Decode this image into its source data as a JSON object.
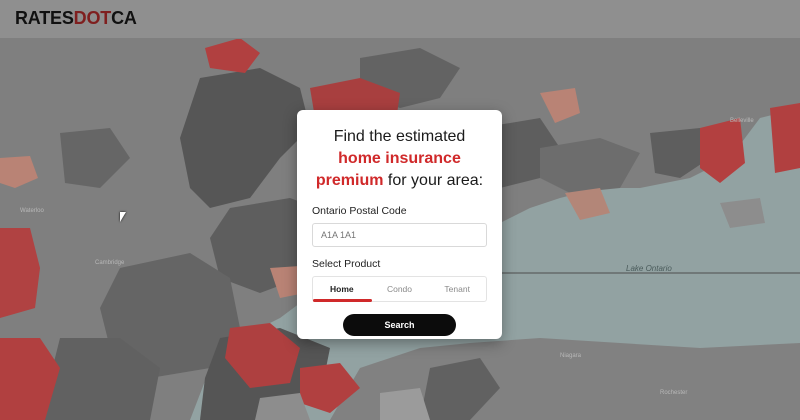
{
  "brand": {
    "logo_part1": "RATES",
    "logo_part2": "DOT",
    "logo_part3": "CA"
  },
  "card": {
    "title_line1": "Find the estimated",
    "title_accent1": "home insurance",
    "title_accent2": "premium",
    "title_rest": " for your area:",
    "postal_label": "Ontario Postal Code",
    "postal_placeholder": "A1A 1A1",
    "product_label": "Select Product",
    "tabs": [
      "Home",
      "Condo",
      "Tenant"
    ],
    "active_tab": "Home",
    "search_label": "Search"
  },
  "map": {
    "lake_label": "Lake Ontario",
    "colors": {
      "water": "#9fb0b0",
      "land": "#858585",
      "dark_region": "#5a5a5a",
      "mid_region": "#6c6c6c",
      "red_region": "#c04646",
      "salmon_region": "#c98f7f",
      "accent": "#d0292a"
    }
  }
}
